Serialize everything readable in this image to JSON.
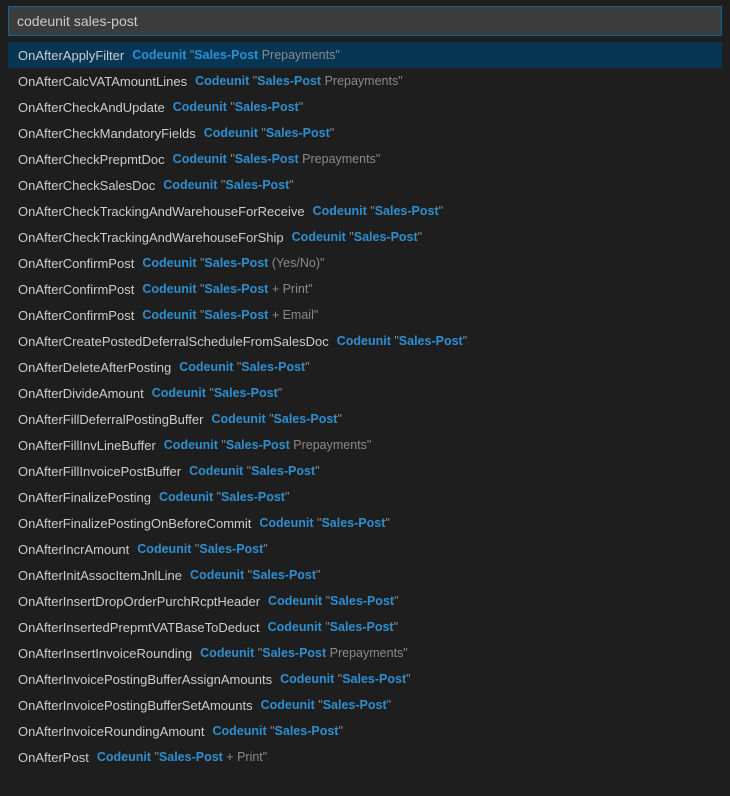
{
  "search": {
    "value": "codeunit sales-post",
    "placeholder": ""
  },
  "tokens": {
    "codeunit": "Codeunit",
    "quote_open": " \"",
    "quote_close": "\"",
    "module": "Sales-Post"
  },
  "items": [
    {
      "event": "OnAfterApplyFilter",
      "suffix": " Prepayments",
      "selected": true
    },
    {
      "event": "OnAfterCalcVATAmountLines",
      "suffix": " Prepayments",
      "selected": false
    },
    {
      "event": "OnAfterCheckAndUpdate",
      "suffix": "",
      "selected": false
    },
    {
      "event": "OnAfterCheckMandatoryFields",
      "suffix": "",
      "selected": false
    },
    {
      "event": "OnAfterCheckPrepmtDoc",
      "suffix": " Prepayments",
      "selected": false
    },
    {
      "event": "OnAfterCheckSalesDoc",
      "suffix": "",
      "selected": false
    },
    {
      "event": "OnAfterCheckTrackingAndWarehouseForReceive",
      "suffix": "",
      "selected": false
    },
    {
      "event": "OnAfterCheckTrackingAndWarehouseForShip",
      "suffix": "",
      "selected": false
    },
    {
      "event": "OnAfterConfirmPost",
      "suffix": " (Yes/No)",
      "selected": false
    },
    {
      "event": "OnAfterConfirmPost",
      "suffix": " + Print",
      "selected": false
    },
    {
      "event": "OnAfterConfirmPost",
      "suffix": " + Email",
      "selected": false
    },
    {
      "event": "OnAfterCreatePostedDeferralScheduleFromSalesDoc",
      "suffix": "",
      "selected": false
    },
    {
      "event": "OnAfterDeleteAfterPosting",
      "suffix": "",
      "selected": false
    },
    {
      "event": "OnAfterDivideAmount",
      "suffix": "",
      "selected": false
    },
    {
      "event": "OnAfterFillDeferralPostingBuffer",
      "suffix": "",
      "selected": false
    },
    {
      "event": "OnAfterFillInvLineBuffer",
      "suffix": " Prepayments",
      "selected": false
    },
    {
      "event": "OnAfterFillInvoicePostBuffer",
      "suffix": "",
      "selected": false
    },
    {
      "event": "OnAfterFinalizePosting",
      "suffix": "",
      "selected": false
    },
    {
      "event": "OnAfterFinalizePostingOnBeforeCommit",
      "suffix": "",
      "selected": false
    },
    {
      "event": "OnAfterIncrAmount",
      "suffix": "",
      "selected": false
    },
    {
      "event": "OnAfterInitAssocItemJnlLine",
      "suffix": "",
      "selected": false
    },
    {
      "event": "OnAfterInsertDropOrderPurchRcptHeader",
      "suffix": "",
      "selected": false
    },
    {
      "event": "OnAfterInsertedPrepmtVATBaseToDeduct",
      "suffix": "",
      "selected": false
    },
    {
      "event": "OnAfterInsertInvoiceRounding",
      "suffix": " Prepayments",
      "selected": false
    },
    {
      "event": "OnAfterInvoicePostingBufferAssignAmounts",
      "suffix": "",
      "selected": false
    },
    {
      "event": "OnAfterInvoicePostingBufferSetAmounts",
      "suffix": "",
      "selected": false
    },
    {
      "event": "OnAfterInvoiceRoundingAmount",
      "suffix": "",
      "selected": false
    },
    {
      "event": "OnAfterPost",
      "suffix": " + Print",
      "selected": false
    }
  ]
}
